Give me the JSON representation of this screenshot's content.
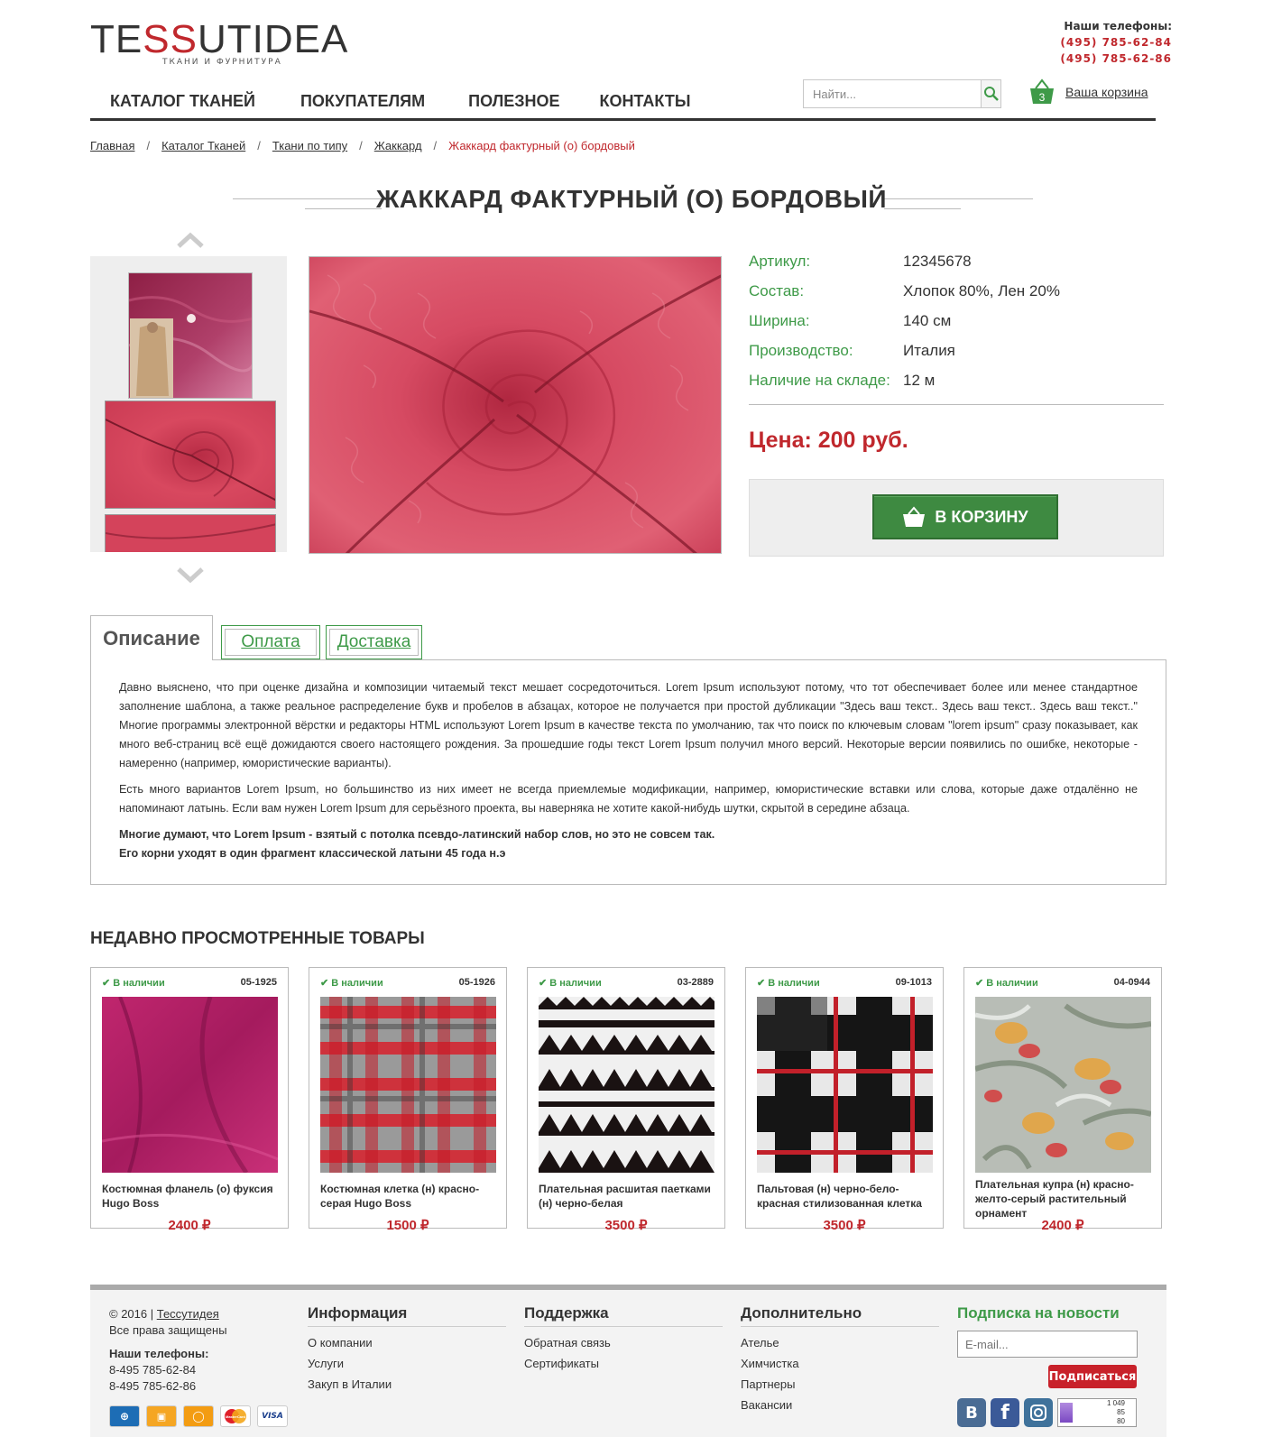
{
  "brand": {
    "logo_text_a": "TE",
    "logo_text_ss": "SS",
    "logo_text_b": "UTIDEA",
    "tagline": "ТКАНИ И ФУРНИТУРА"
  },
  "header_phones": {
    "title": "Наши телефоны:",
    "phone1": "(495) 785-62-84",
    "phone2": "(495) 785-62-86"
  },
  "nav": {
    "items": [
      "КАТАЛОГ ТКАНЕЙ",
      "ПОКУПАТЕЛЯМ",
      "ПОЛЕЗНОЕ",
      "КОНТАКТЫ"
    ]
  },
  "search": {
    "placeholder": "Найти...",
    "icon": "search-icon"
  },
  "cart": {
    "count": "3",
    "label": "Ваша корзина",
    "icon": "basket-icon"
  },
  "breadcrumb": {
    "items": [
      "Главная",
      "Каталог Тканей",
      "Ткани по типу",
      "Жаккард"
    ],
    "current": "Жаккард фактурный (о) бордовый",
    "separator": "/"
  },
  "product": {
    "title": "ЖАККАРД ФАКТУРНЫЙ (О) БОРДОВЫЙ",
    "specs": [
      {
        "label": "Артикул:",
        "value": "12345678"
      },
      {
        "label": "Состав:",
        "value": "Хлопок 80%, Лен 20%"
      },
      {
        "label": "Ширина:",
        "value": "140 см"
      },
      {
        "label": "Производство:",
        "value": "Италия"
      },
      {
        "label": "Наличие на складе:",
        "value": "12 м"
      }
    ],
    "price": "Цена: 200 руб.",
    "buy_label": "В КОРЗИНУ"
  },
  "tabs": {
    "items": [
      "Описание",
      "Оплата",
      "Доставка"
    ],
    "active": "Описание",
    "paragraph1": "Давно выяснено, что при оценке дизайна и композиции читаемый текст мешает сосредоточиться. Lorem Ipsum используют потому, что тот обеспечивает более или менее стандартное заполнение шаблона, а также реальное распределение букв и пробелов в абзацах, которое не получается при простой дубликации \"Здесь ваш текст.. Здесь ваш текст.. Здесь ваш текст..\" Многие программы электронной вёрстки и редакторы HTML используют Lorem Ipsum в качестве текста по умолчанию, так что поиск по ключевым словам \"lorem ipsum\" сразу показывает, как много веб-страниц всё ещё дожидаются своего настоящего рождения. За прошедшие годы текст Lorem Ipsum получил много версий. Некоторые версии появились по ошибке, некоторые - намеренно (например, юмористические варианты).",
    "paragraph2": "Есть много вариантов Lorem Ipsum, но большинство из них имеет не всегда приемлемые модификации, например, юмористические вставки или слова, которые даже отдалённо не напоминают латынь. Если вам нужен Lorem Ipsum для серьёзного проекта, вы наверняка не хотите какой-нибудь шутки, скрытой в середине абзаца.",
    "bold1": "Многие думают, что Lorem Ipsum - взятый с потолка псевдо-латинский набор слов, но это не совсем так.",
    "bold2": "Его корни уходят в один фрагмент классической латыни 45 года н.э"
  },
  "recent": {
    "title": "НЕДАВНО ПРОСМОТРЕННЫЕ ТОВАРЫ",
    "items": [
      {
        "stock": "В наличии",
        "code": "05-1925",
        "name": "Костюмная фланель (о) фуксия Hugo Boss",
        "price": "2400 ₽"
      },
      {
        "stock": "В наличии",
        "code": "05-1926",
        "name": "Костюмная клетка (н) красно-серая Hugo Boss",
        "price": "1500 ₽"
      },
      {
        "stock": "В наличии",
        "code": "03-2889",
        "name": "Плательная расшитая паетками (н) черно-белая",
        "price": "3500 ₽"
      },
      {
        "stock": "В наличии",
        "code": "09-1013",
        "name": "Пальтовая (н) черно-бело-красная стилизованная клетка",
        "price": "3500 ₽"
      },
      {
        "stock": "В наличии",
        "code": "04-0944",
        "name": "Плательная купра (н) красно-желто-серый растительный орнамент",
        "price": "2400 ₽"
      }
    ]
  },
  "footer": {
    "copyright": "© 2016 |",
    "company_link": "Тессутидея",
    "rights": "Все права защищены",
    "phones_title": "Наши телефоны:",
    "phone1": "8-495 785-62-84",
    "phone2": "8-495 785-62-86",
    "info": {
      "title": "Информация",
      "links": [
        "О компании",
        "Услуги",
        "Закуп в Италии"
      ]
    },
    "support": {
      "title": "Поддержка",
      "links": [
        "Обратная связь",
        "Сертификаты"
      ]
    },
    "extra": {
      "title": "Дополнительно",
      "links": [
        "Ателье",
        "Химчистка",
        "Партнеры",
        "Вакансии"
      ]
    },
    "subscribe": {
      "title": "Подписка на новости",
      "placeholder": "E-mail...",
      "button": "Подписаться"
    },
    "payments": [
      "webmoney-icon",
      "yandex-money-icon",
      "qiwi-icon",
      "mastercard-icon",
      "visa-icon"
    ],
    "payment_texts": {
      "mastercard": "MasterCard",
      "visa": "VISA"
    },
    "socials": [
      "vk-icon",
      "facebook-icon",
      "instagram-icon",
      "liveinternet-counter"
    ],
    "social_glyphs": {
      "vk": "В",
      "facebook": "f"
    },
    "counter": [
      "1 049",
      "85",
      "80"
    ]
  },
  "colors": {
    "accent_green": "#3e9a48",
    "accent_red": "#c0282d",
    "button_green": "#3e8a41",
    "text": "#333333"
  }
}
